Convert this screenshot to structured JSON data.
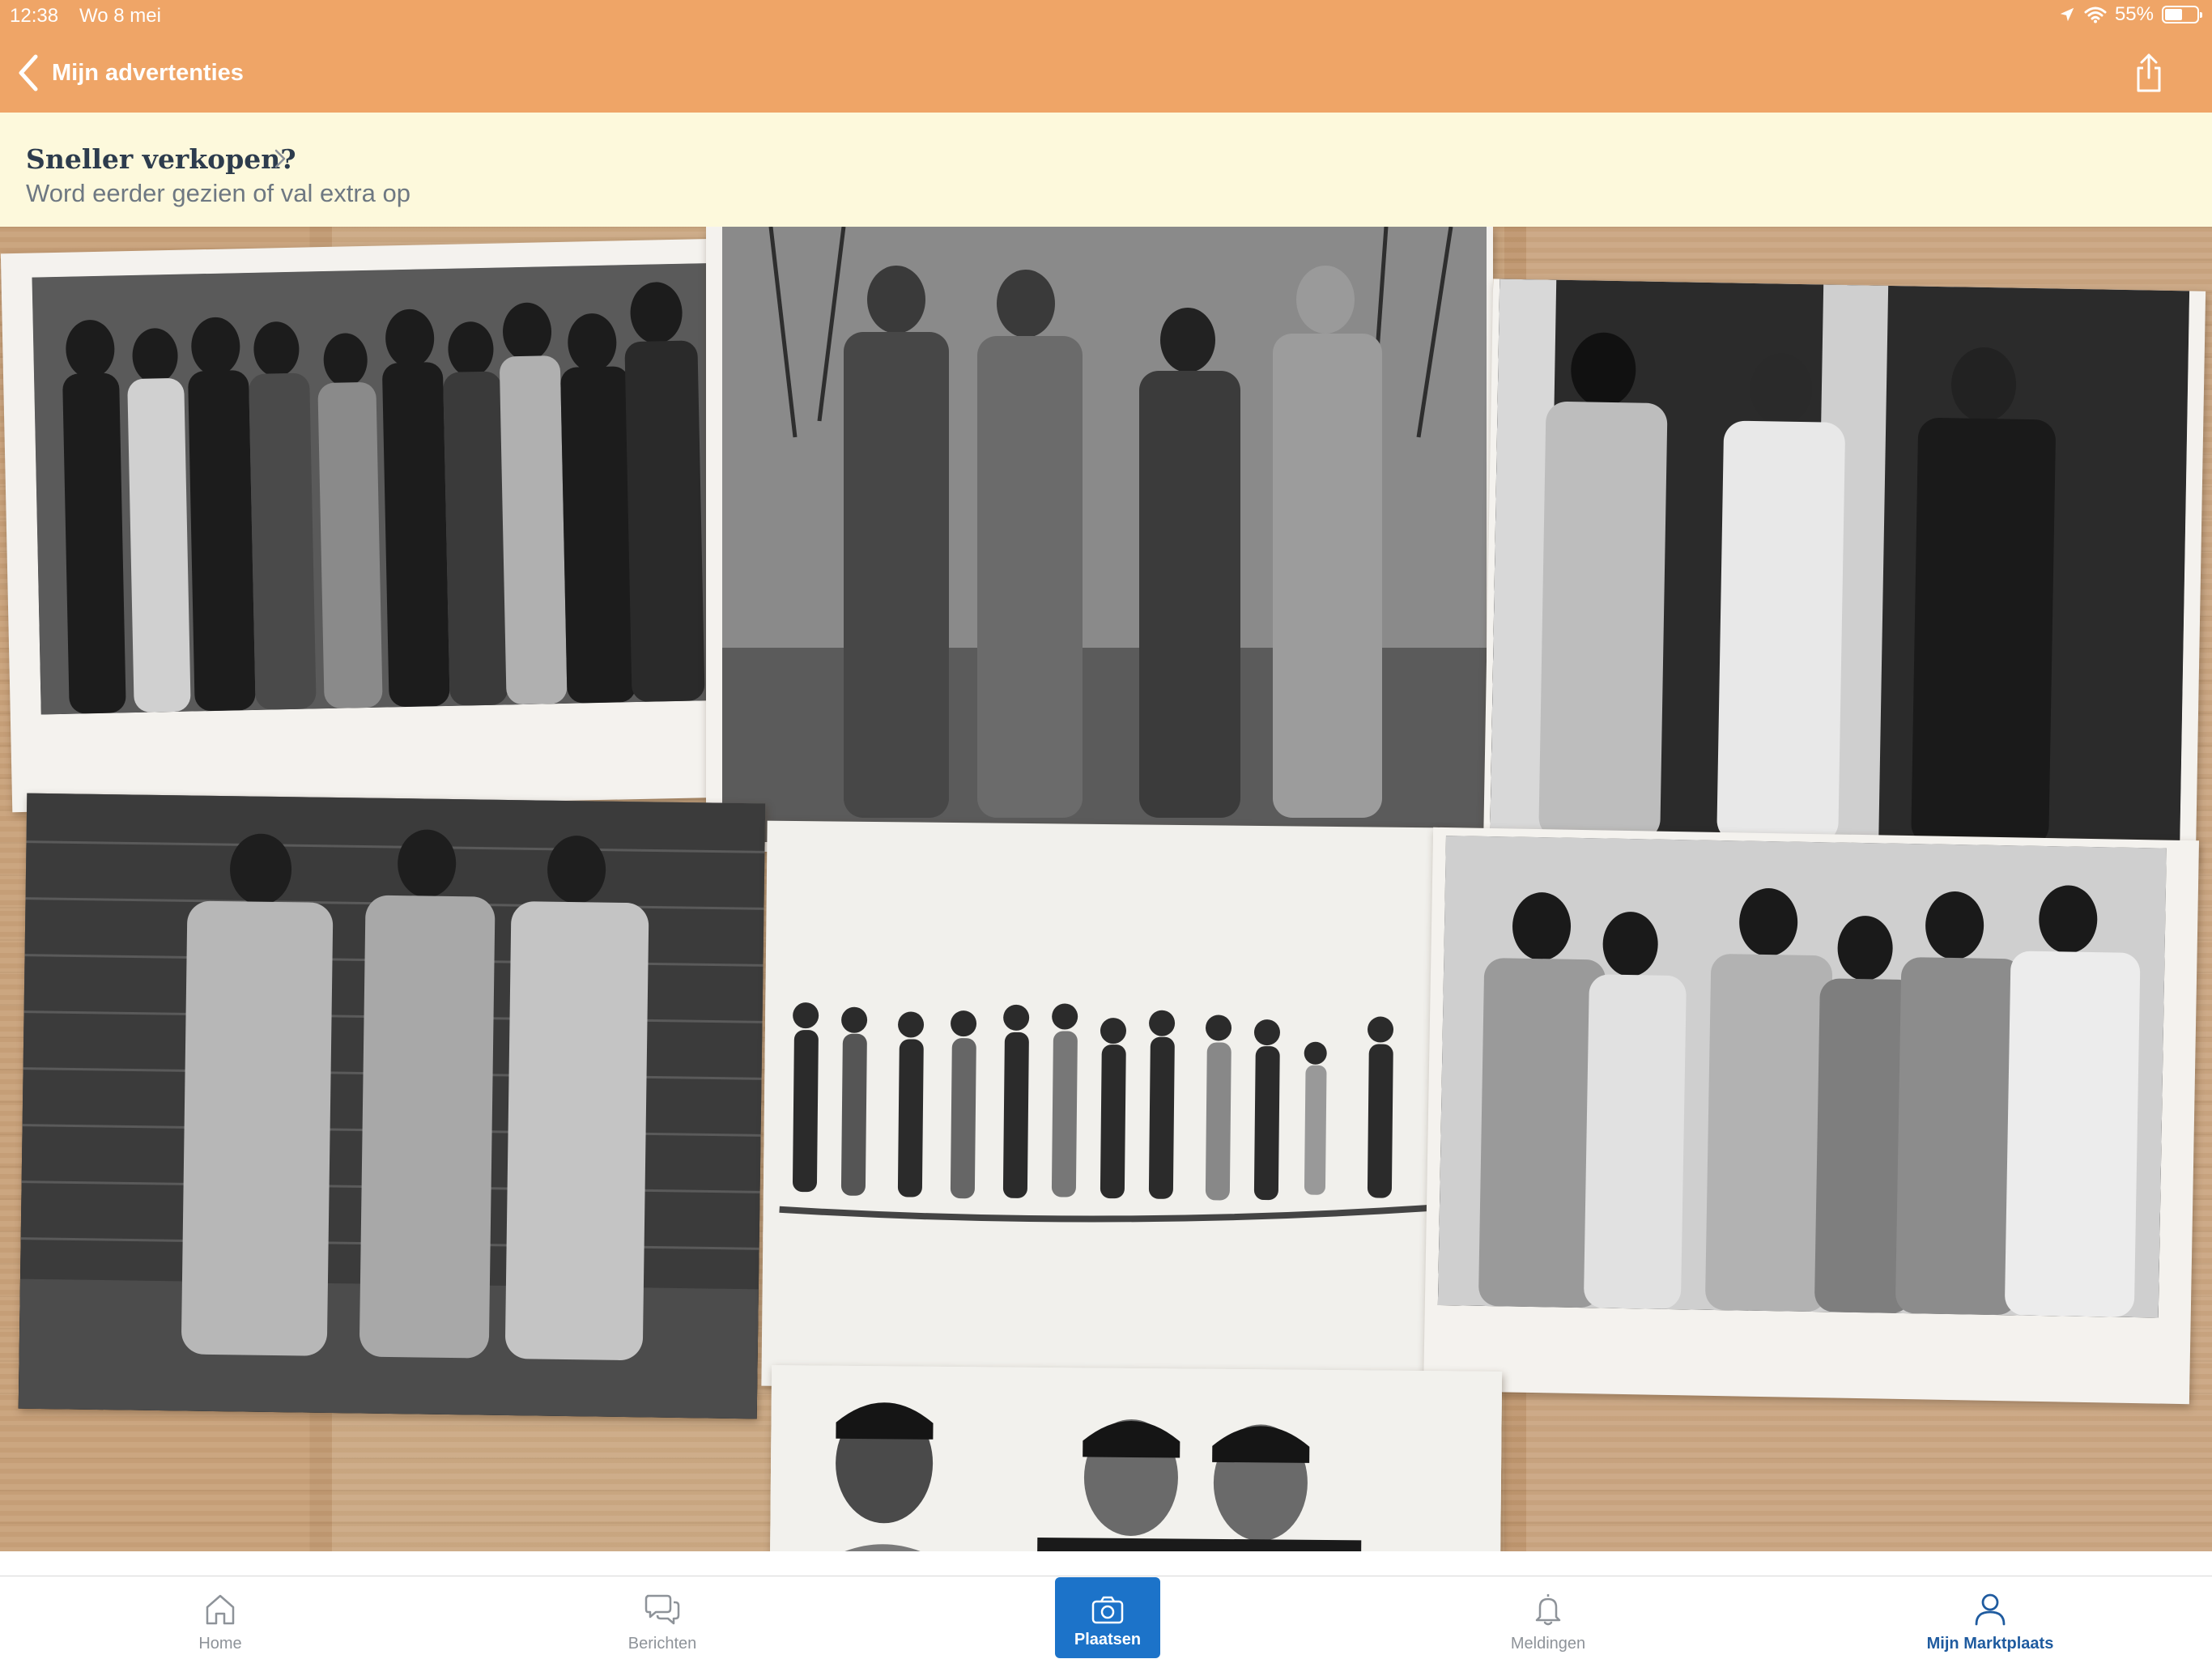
{
  "status_bar": {
    "time": "12:38",
    "date": "Wo 8 mei",
    "battery_text": "55%",
    "battery_level": 0.55,
    "icons": [
      "location-icon",
      "wifi-icon",
      "battery-icon"
    ]
  },
  "nav": {
    "back_label": "Mijn advertenties",
    "back_icon": "chevron-left-icon",
    "share_icon": "share-icon"
  },
  "promo": {
    "title": "Sneller verkopen?",
    "subtitle": "Word eerder gezien of val extra op",
    "chevron_icon": "chevron-right-icon"
  },
  "photo": {
    "content": "Collage of vintage black-and-white fashion press photographs on a wooden floor",
    "prints": [
      "group-portrait",
      "suits-outdoor",
      "coats-doorway",
      "trio-brick-wall",
      "swimsuit-lineup",
      "jackets-group",
      "three-men-portrait"
    ]
  },
  "tabbar": {
    "tabs": [
      {
        "label": "Home",
        "icon": "home-icon",
        "active": false
      },
      {
        "label": "Berichten",
        "icon": "chat-bubbles-icon",
        "active": false
      },
      {
        "label": "Plaatsen",
        "icon": "camera-icon",
        "active": false
      },
      {
        "label": "Meldingen",
        "icon": "bell-icon",
        "active": false
      },
      {
        "label": "Mijn Marktplaats",
        "icon": "person-icon",
        "active": true
      }
    ]
  },
  "colors": {
    "header": "#efa567",
    "promo_bg": "#fdf9dc",
    "promo_title": "#2d3c4d",
    "accent_blue": "#1c73c9",
    "active_tab": "#1f5b9f",
    "inactive_tab": "#8e9399"
  }
}
